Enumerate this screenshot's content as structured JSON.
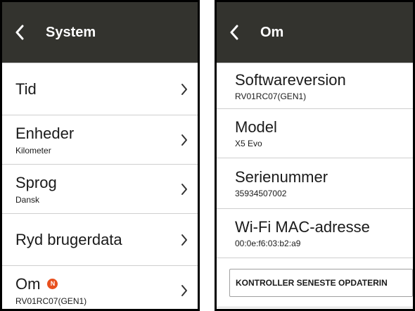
{
  "left": {
    "header": {
      "title": "System",
      "back_icon": "chevron-left-icon"
    },
    "items": [
      {
        "label": "Tid",
        "sub": ""
      },
      {
        "label": "Enheder",
        "sub": "Kilometer"
      },
      {
        "label": "Sprog",
        "sub": "Dansk"
      },
      {
        "label": "Ryd brugerdata",
        "sub": ""
      },
      {
        "label": "Om",
        "sub": "RV01RC07(GEN1)",
        "badge": "N"
      }
    ]
  },
  "right": {
    "header": {
      "title": "Om",
      "back_icon": "chevron-left-icon"
    },
    "items": [
      {
        "label": "Softwareversion",
        "value": "RV01RC07(GEN1)"
      },
      {
        "label": "Model",
        "value": "X5 Evo"
      },
      {
        "label": "Serienummer",
        "value": "35934507002"
      },
      {
        "label": "Wi-Fi MAC-adresse",
        "value": "00:0e:f6:03:b2:a9"
      }
    ],
    "update_button": "KONTROLLER SENESTE OPDATERIN"
  },
  "colors": {
    "header_bg": "#33332e",
    "header_text": "#ffffff",
    "badge": "#e8501e",
    "divider": "#cfcfcf"
  }
}
